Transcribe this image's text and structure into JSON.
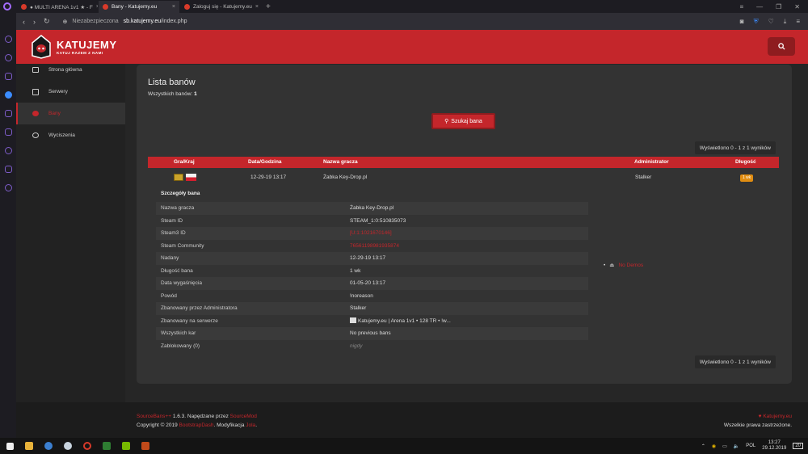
{
  "browser": {
    "tabs": [
      {
        "title": "● MULTI ARENA 1v1 ★ - F",
        "active": false
      },
      {
        "title": "Bany - Katujemy.eu",
        "active": true
      },
      {
        "title": "Zaloguj się - Katujemy.eu",
        "active": false
      }
    ],
    "security_label": "Niezabezpieczona",
    "url_host": "sb.katujemy.eu",
    "url_path": "/index.php"
  },
  "site": {
    "logo_title": "KATUJEMY",
    "logo_subtitle": "KATUJ RAZEM Z NAMI",
    "accent": "#c4262b"
  },
  "nav": {
    "items": [
      {
        "label": "Strona główna",
        "icon": "monitor-icon",
        "active": false
      },
      {
        "label": "Serwery",
        "icon": "server-icon",
        "active": false
      },
      {
        "label": "Bany",
        "icon": "ban-icon",
        "active": true
      },
      {
        "label": "Wyciszenia",
        "icon": "mute-icon",
        "active": false
      }
    ]
  },
  "main": {
    "title": "Lista banów",
    "count_label": "Wszystkich banów:",
    "count_value": "1",
    "search_button": "Szukaj bana",
    "pager_text": "Wyświetlono 0 - 1 z 1 wyników",
    "table": {
      "headers": [
        "Gra/Kraj",
        "Data/Godzina",
        "Nazwa gracza",
        "Administrator",
        "Długość"
      ],
      "row": {
        "date": "12-29-19 13:17",
        "player": "Żabka Key-Drop.pl",
        "admin": "Stalker",
        "length": "1 wk"
      }
    },
    "details": {
      "heading": "Szczegóły bana",
      "rows": [
        {
          "key": "Nazwa gracza",
          "value": "Żabka Key-Drop.pl",
          "style": ""
        },
        {
          "key": "Steam ID",
          "value": "STEAM_1:0:510835073",
          "style": ""
        },
        {
          "key": "Steam3 ID",
          "value": "[U:1:1021670146]",
          "style": "red"
        },
        {
          "key": "Steam Community",
          "value": "76561198981935874",
          "style": "red"
        },
        {
          "key": "Nadany",
          "value": "12-29-19 13:17",
          "style": ""
        },
        {
          "key": "Długość bana",
          "value": "1 wk",
          "style": ""
        },
        {
          "key": "Data wygaśnięcia",
          "value": "01-05-20 13:17",
          "style": ""
        },
        {
          "key": "Powód",
          "value": "!noreason",
          "style": ""
        },
        {
          "key": "Zbanowany przez Administratora",
          "value": "Stalker",
          "style": ""
        },
        {
          "key": "Zbanowany na serwerze",
          "value": "Katujemy.eu | Arena 1v1 • 128 TR • !w...",
          "style": "server"
        },
        {
          "key": "Wszystkich kar",
          "value": "No previous bans",
          "style": ""
        },
        {
          "key": "Zablokowany (0)",
          "value": "nigdy",
          "style": "it"
        }
      ],
      "demo_label": "No Demos"
    }
  },
  "footer": {
    "line1_link": "SourceBans++",
    "line1_text": " 1.6.3. Napędzane przez ",
    "line1_link2": "SourceMod",
    "line2_text": "Copyright © 2019 ",
    "line2_link": "BootstrapDash",
    "line2_text2": ". Modyfikacja ",
    "line2_link2": "Jola",
    "line2_end": ".",
    "right_link": "Katujemy.eu",
    "right_text": "Wszelkie prawa zastrzeżone."
  },
  "taskbar": {
    "lang": "POL",
    "time": "13:27",
    "date": "29.12.2019",
    "notif_count": "20"
  }
}
